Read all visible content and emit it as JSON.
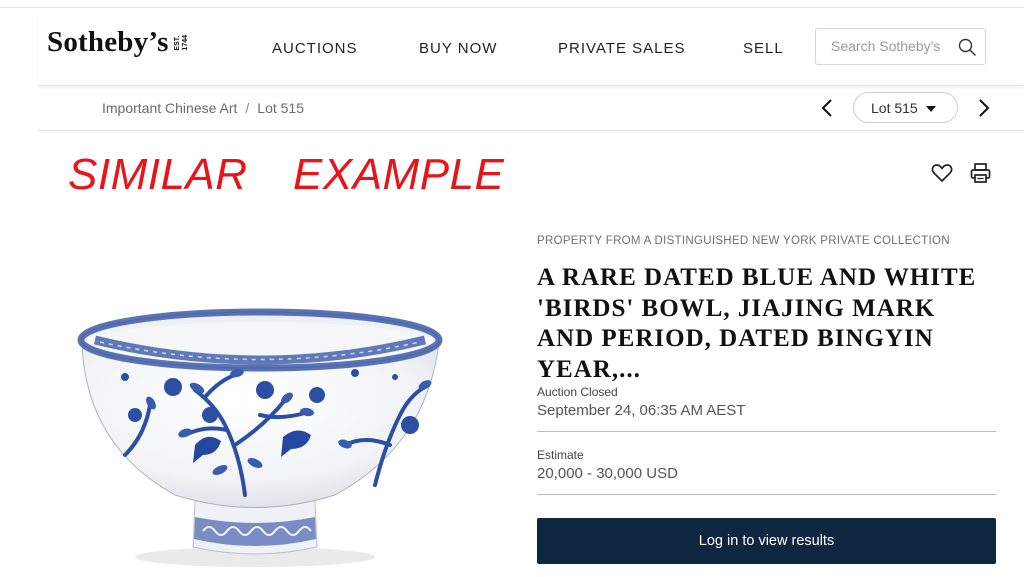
{
  "header": {
    "logo_text": "Sotheby’s",
    "logo_est": [
      "EST.",
      "1744"
    ],
    "nav": [
      "AUCTIONS",
      "BUY NOW",
      "PRIVATE SALES",
      "SELL"
    ],
    "search": {
      "placeholder": "Search Sotheby's",
      "value": ""
    }
  },
  "breadcrumb": {
    "items": [
      "Important Chinese Art",
      "Lot 515"
    ],
    "separator": "/",
    "lot_selector": "Lot 515"
  },
  "overlay_text": "SIMILAR  EXAMPLE",
  "lot": {
    "provenance": "PROPERTY FROM A DISTINGUISHED NEW YORK PRIVATE COLLECTION",
    "title": "A RARE DATED BLUE AND WHITE 'BIRDS' BOWL, JIAJING MARK AND PERIOD, DATED BINGYIN YEAR,...",
    "status_label": "Auction Closed",
    "status_value": "September 24, 06:35 AM AEST",
    "estimate_label": "Estimate",
    "estimate_value": "20,000 - 30,000 USD",
    "cta": "Log in to view results"
  },
  "colors": {
    "accent_navy": "#0f2640",
    "overlay_red": "#e8141a",
    "porcelain_blue": "#2d4fa3"
  },
  "icons": [
    "search-icon",
    "chevron-left-icon",
    "chevron-right-icon",
    "caret-down-icon",
    "heart-icon",
    "print-icon"
  ]
}
